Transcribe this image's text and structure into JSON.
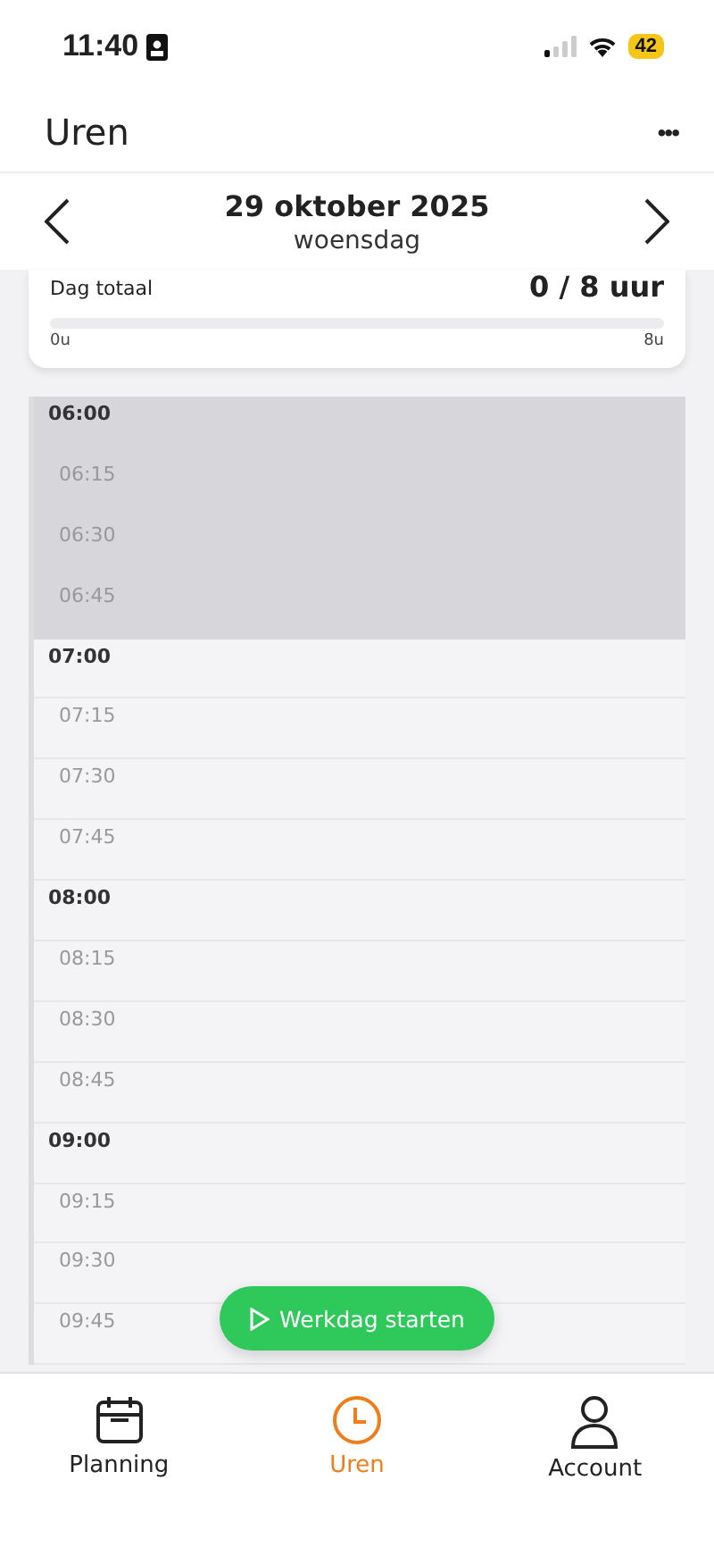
{
  "status_bar": {
    "time": "11:40",
    "battery": "42"
  },
  "header": {
    "title": "Uren",
    "menu": "•••"
  },
  "date_nav": {
    "date": "29 oktober 2025",
    "weekday": "woensdag"
  },
  "day_total": {
    "label": "Dag totaal",
    "value": "0 / 8 uur",
    "level": 0,
    "min_label": "0u",
    "max_label": "8u"
  },
  "timeline": [
    {
      "time": "06:00",
      "kind": "hour",
      "shaded": true
    },
    {
      "time": "06:15",
      "kind": "quarter",
      "shaded": true
    },
    {
      "time": "06:30",
      "kind": "quarter",
      "shaded": true
    },
    {
      "time": "06:45",
      "kind": "quarter",
      "shaded": true
    },
    {
      "time": "07:00",
      "kind": "hour",
      "shaded": false
    },
    {
      "time": "07:15",
      "kind": "quarter",
      "shaded": false
    },
    {
      "time": "07:30",
      "kind": "quarter",
      "shaded": false
    },
    {
      "time": "07:45",
      "kind": "quarter",
      "shaded": false
    },
    {
      "time": "08:00",
      "kind": "hour",
      "shaded": false
    },
    {
      "time": "08:15",
      "kind": "quarter",
      "shaded": false
    },
    {
      "time": "08:30",
      "kind": "quarter",
      "shaded": false
    },
    {
      "time": "08:45",
      "kind": "quarter",
      "shaded": false
    },
    {
      "time": "09:00",
      "kind": "hour",
      "shaded": false
    },
    {
      "time": "09:15",
      "kind": "quarter",
      "shaded": false
    },
    {
      "time": "09:30",
      "kind": "quarter",
      "shaded": false
    },
    {
      "time": "09:45",
      "kind": "quarter",
      "shaded": false
    }
  ],
  "start_button": {
    "label": "Werkdag starten"
  },
  "tab_bar": [
    {
      "label": "Planning",
      "kind": "calendar",
      "selected": false
    },
    {
      "label": "Uren",
      "kind": "clock",
      "selected": true
    },
    {
      "label": "Account",
      "kind": "person",
      "selected": false
    }
  ]
}
